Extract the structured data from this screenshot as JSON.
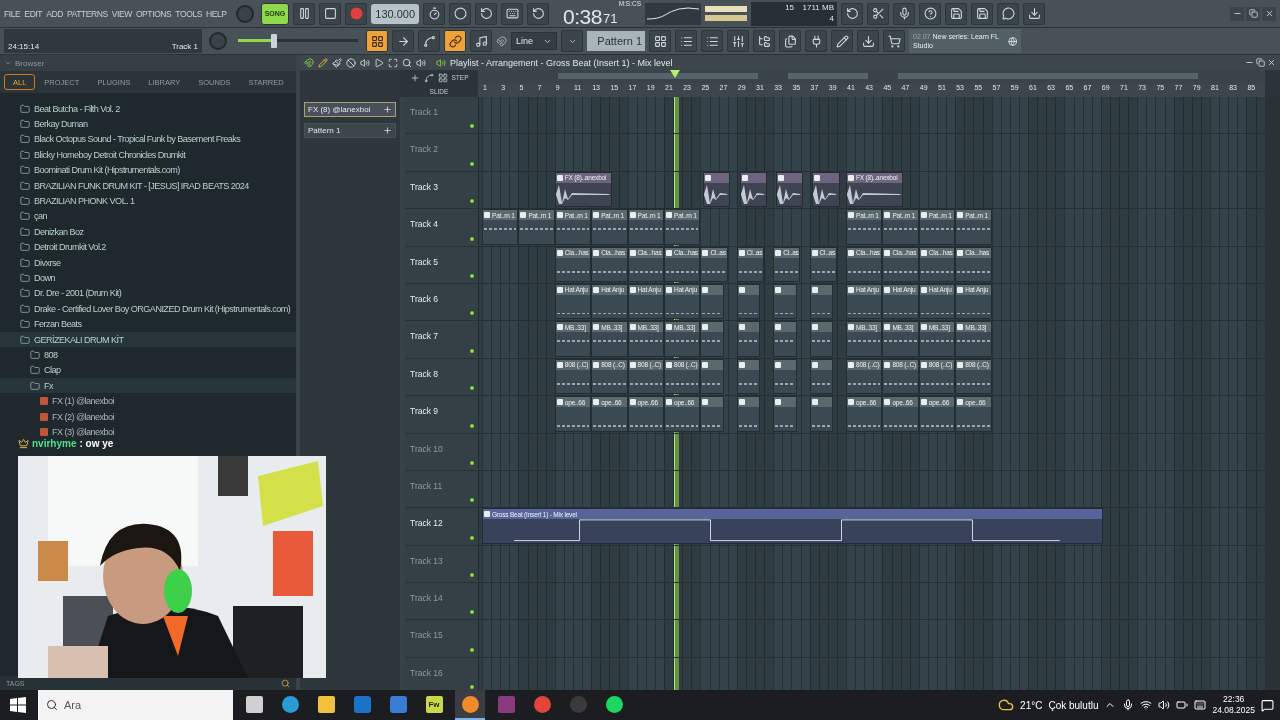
{
  "menu": [
    "FILE",
    "EDIT",
    "ADD",
    "PATTERNS",
    "VIEW",
    "OPTIONS",
    "TOOLS",
    "HELP"
  ],
  "transport": {
    "mode_label": "SONG",
    "song_mode": true,
    "tempo": "130.000"
  },
  "time": {
    "value": "0:38",
    "fraction": "71",
    "unit": "M:S:CS"
  },
  "cpu": {
    "value": "15",
    "memory": "1711 MB",
    "polyphony": "4"
  },
  "hint": {
    "time": "24:15:14",
    "target": "Track 1"
  },
  "master_volume": {
    "level": 0.3
  },
  "tool_toggles": [
    {
      "kind": "playlist",
      "on": true
    },
    {
      "kind": "arrow",
      "on": false
    },
    {
      "kind": "curve",
      "on": false
    },
    {
      "kind": "link",
      "on": true
    },
    {
      "kind": "hat",
      "on": false
    }
  ],
  "snap": "Line",
  "pattern": "Pattern 1",
  "news": {
    "date": "02.07",
    "text": "New series: Learn FL Studio"
  },
  "browser": {
    "title": "Browser",
    "tabs": [
      {
        "label": "ALL",
        "selected": true
      },
      {
        "label": "PROJECT",
        "selected": false
      },
      {
        "label": "PLUGINS",
        "selected": false
      },
      {
        "label": "LIBRARY",
        "selected": false
      },
      {
        "label": "SOUNDS",
        "selected": false
      },
      {
        "label": "STARRED",
        "selected": false
      }
    ],
    "items": [
      {
        "label": "Beat Butcha - Filth Vol. 2",
        "kind": "folder",
        "expanded": false
      },
      {
        "label": "Berkay Duman",
        "kind": "folder",
        "expanded": false
      },
      {
        "label": "Black Octopus Sound - Tropical Funk by Basement Freaks",
        "kind": "folder",
        "expanded": false
      },
      {
        "label": "Blicky Homeboy Detroit Chronicles Drumkit",
        "kind": "folder",
        "expanded": false
      },
      {
        "label": "Boominati Drum Kit (Hipstrumentals.com)",
        "kind": "folder",
        "expanded": false
      },
      {
        "label": "BRAZILIAN FUNK DRUM KIT - [JESUS] IRAD BEATS 2024",
        "kind": "folder",
        "expanded": false
      },
      {
        "label": "BRAZILIAN PHONK VOL. 1",
        "kind": "folder",
        "expanded": false
      },
      {
        "label": "çan",
        "kind": "folder",
        "expanded": false
      },
      {
        "label": "Denizkan Boz",
        "kind": "folder",
        "expanded": false
      },
      {
        "label": "Detroit Drumkit Vol.2",
        "kind": "folder",
        "expanded": false
      },
      {
        "label": "Divxrse",
        "kind": "folder",
        "expanded": false
      },
      {
        "label": "Down",
        "kind": "folder",
        "expanded": false
      },
      {
        "label": "Dr. Dre - 2001 (Drum Kit)",
        "kind": "folder",
        "expanded": false
      },
      {
        "label": "Drake - Certified Lover Boy ORGANIZED Drum Kit (Hipstrumentals.com)",
        "kind": "folder",
        "expanded": false
      },
      {
        "label": "Ferzan Beats",
        "kind": "folder",
        "expanded": false
      },
      {
        "label": "GERİZEKALI DRUM KİT",
        "kind": "folder",
        "expanded": true,
        "children": [
          {
            "label": "808",
            "kind": "folder",
            "expanded": false
          },
          {
            "label": "Clap",
            "kind": "folder",
            "expanded": false
          },
          {
            "label": "Fx",
            "kind": "folder",
            "expanded": true,
            "children": [
              {
                "label": "FX (1) @lanexboi",
                "kind": "file"
              },
              {
                "label": "FX (2) @lanexboi",
                "kind": "file"
              },
              {
                "label": "FX (3) @lanexboi",
                "kind": "file"
              }
            ]
          }
        ]
      }
    ],
    "tags_label": "TAGS"
  },
  "chat": {
    "user": "nvirhyme",
    "message": ": ow ye"
  },
  "pattern_picker": [
    {
      "label": "FX (8) @lanexboi",
      "selected": true
    },
    {
      "label": "Pattern 1",
      "selected": false
    }
  ],
  "playlist": {
    "title": "Playlist - Arrangement - Gross Beat (Insert 1) - Mix level",
    "step_label": "STEP",
    "slide_label": "SLIDE",
    "ruler": [
      "1",
      "3",
      "5",
      "7",
      "9",
      "11",
      "13",
      "15",
      "17",
      "19",
      "21",
      "23",
      "25",
      "27",
      "29",
      "31",
      "33",
      "35",
      "37",
      "39",
      "41",
      "43",
      "45",
      "47",
      "49",
      "51",
      "53",
      "55",
      "57",
      "59",
      "61",
      "63",
      "65",
      "67",
      "69",
      "71",
      "73",
      "75",
      "77",
      "79",
      "81",
      "83",
      "85"
    ],
    "tracks": [
      {
        "name": "Track 1",
        "empty": true
      },
      {
        "name": "Track 2",
        "empty": true
      },
      {
        "name": "Track 3",
        "empty": false,
        "clips": [
          {
            "kind": "audio",
            "label": "FX (8)..anexboi"
          },
          {
            "kind": "audio"
          },
          {
            "kind": "audio"
          },
          {
            "kind": "audio"
          },
          {
            "kind": "audio"
          },
          {
            "kind": "audio",
            "label": "FX (8)..anexboi"
          }
        ]
      },
      {
        "name": "Track 4",
        "empty": false,
        "clips": [
          {
            "kind": "pattern",
            "label": "Pat..rn 1"
          },
          {
            "kind": "pattern",
            "label": "Pat..rn 1"
          },
          {
            "kind": "pattern",
            "label": "Pat..rn 1"
          },
          {
            "kind": "pattern",
            "label": "Pat..rn 1"
          },
          {
            "kind": "pattern",
            "label": "Pat..rn 1"
          },
          {
            "kind": "pattern",
            "label": "Pat..rn 1"
          },
          {
            "kind": "pattern",
            "label": "Pat..rn 1"
          },
          {
            "kind": "pattern",
            "label": "Pat..rn 1"
          },
          {
            "kind": "pattern",
            "label": "Pat..rn 1"
          },
          {
            "kind": "pattern",
            "label": "Pat..rn 1"
          }
        ]
      },
      {
        "name": "Track 5",
        "empty": false,
        "clips": [
          {
            "kind": "pattern",
            "label": "Cla...has"
          },
          {
            "kind": "pattern",
            "label": "Cla...has"
          },
          {
            "kind": "pattern",
            "label": "Cla...has"
          },
          {
            "kind": "pattern",
            "label": "Cla...has"
          },
          {
            "kind": "pattern",
            "label": "Cl..as"
          },
          {
            "kind": "pattern",
            "label": "Cl..as"
          },
          {
            "kind": "pattern",
            "label": "Cl..as"
          },
          {
            "kind": "pattern",
            "label": "Cl..as"
          },
          {
            "kind": "pattern",
            "label": "Cla...has"
          },
          {
            "kind": "pattern",
            "label": "Cla...has"
          },
          {
            "kind": "pattern",
            "label": "Cla...has"
          },
          {
            "kind": "pattern",
            "label": "Cla...has"
          }
        ]
      },
      {
        "name": "Track 6",
        "empty": false,
        "clips": [
          {
            "kind": "pattern",
            "label": "Hat Anju"
          },
          {
            "kind": "pattern",
            "label": "Hat Anju"
          },
          {
            "kind": "pattern",
            "label": "Hat Anju"
          },
          {
            "kind": "pattern",
            "label": "Hat Anju"
          },
          {
            "kind": "pattern"
          },
          {
            "kind": "pattern"
          },
          {
            "kind": "pattern"
          },
          {
            "kind": "pattern"
          },
          {
            "kind": "pattern",
            "label": "Hat Anju"
          },
          {
            "kind": "pattern",
            "label": "Hat Anju"
          },
          {
            "kind": "pattern",
            "label": "Hat Anju"
          },
          {
            "kind": "pattern",
            "label": "Hat Anju"
          }
        ]
      },
      {
        "name": "Track 7",
        "empty": false,
        "clips": [
          {
            "kind": "pattern",
            "label": "MB..33]"
          },
          {
            "kind": "pattern",
            "label": "MB..33]"
          },
          {
            "kind": "pattern",
            "label": "MB..33]"
          },
          {
            "kind": "pattern",
            "label": "MB..33]"
          },
          {
            "kind": "pattern"
          },
          {
            "kind": "pattern"
          },
          {
            "kind": "pattern"
          },
          {
            "kind": "pattern"
          },
          {
            "kind": "pattern",
            "label": "MB..33]"
          },
          {
            "kind": "pattern",
            "label": "MB..33]"
          },
          {
            "kind": "pattern",
            "label": "MB..33]"
          },
          {
            "kind": "pattern",
            "label": "MB..33]"
          }
        ]
      },
      {
        "name": "Track 8",
        "empty": false,
        "clips": [
          {
            "kind": "pattern",
            "label": "808 (..C)"
          },
          {
            "kind": "pattern",
            "label": "808 (..C)"
          },
          {
            "kind": "pattern",
            "label": "808 (..C)"
          },
          {
            "kind": "pattern",
            "label": "808 (..C)"
          },
          {
            "kind": "pattern"
          },
          {
            "kind": "pattern"
          },
          {
            "kind": "pattern"
          },
          {
            "kind": "pattern"
          },
          {
            "kind": "pattern",
            "label": "808 (..C)"
          },
          {
            "kind": "pattern",
            "label": "808 (..C)"
          },
          {
            "kind": "pattern",
            "label": "808 (..C)"
          },
          {
            "kind": "pattern",
            "label": "808 (..C)"
          }
        ]
      },
      {
        "name": "Track 9",
        "empty": false,
        "clips": [
          {
            "kind": "pattern",
            "label": "ope..66"
          },
          {
            "kind": "pattern",
            "label": "ope..66"
          },
          {
            "kind": "pattern",
            "label": "ope..66"
          },
          {
            "kind": "pattern",
            "label": "ope..66"
          },
          {
            "kind": "pattern"
          },
          {
            "kind": "pattern"
          },
          {
            "kind": "pattern"
          },
          {
            "kind": "pattern"
          },
          {
            "kind": "pattern",
            "label": "ope..66"
          },
          {
            "kind": "pattern",
            "label": "ope..66"
          },
          {
            "kind": "pattern",
            "label": "ope..66"
          },
          {
            "kind": "pattern",
            "label": "ope..66"
          }
        ]
      },
      {
        "name": "Track 10",
        "empty": true
      },
      {
        "name": "Track 11",
        "empty": true
      },
      {
        "name": "Track 12",
        "empty": false,
        "clips": [
          {
            "kind": "automation",
            "label": "Gross Beat (Insert 1) - Mix level"
          }
        ]
      },
      {
        "name": "Track 13",
        "empty": true
      },
      {
        "name": "Track 14",
        "empty": true
      },
      {
        "name": "Track 15",
        "empty": true
      },
      {
        "name": "Track 16",
        "empty": true
      }
    ]
  },
  "taskbar": {
    "search_placeholder": "Ara",
    "apps": [
      {
        "kind": "taskview",
        "selected": false
      },
      {
        "kind": "edge",
        "selected": false
      },
      {
        "kind": "explorer",
        "selected": false
      },
      {
        "kind": "outlook",
        "selected": false
      },
      {
        "kind": "store",
        "selected": false
      },
      {
        "kind": "fw",
        "label": "Fw",
        "selected": false
      },
      {
        "kind": "flstudio",
        "selected": true
      },
      {
        "kind": "winrar",
        "selected": false
      },
      {
        "kind": "chrome",
        "selected": false
      },
      {
        "kind": "obs",
        "selected": false
      },
      {
        "kind": "spotify",
        "selected": false
      }
    ],
    "temperature": "21°C",
    "weather": "Çok bulutlu",
    "time": "22:36",
    "date": "24.08.2025"
  }
}
